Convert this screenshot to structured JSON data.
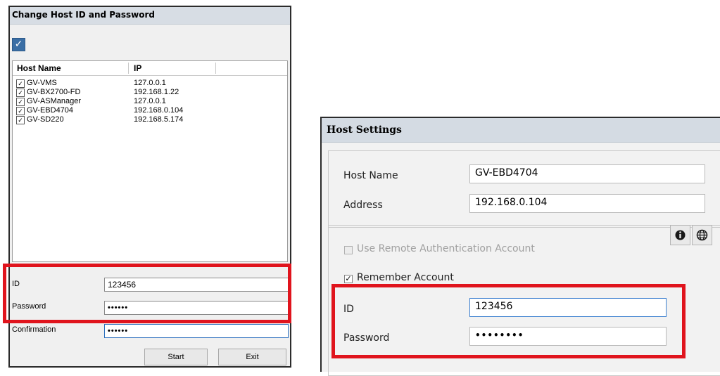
{
  "left_dialog": {
    "title": "Change Host ID and Password",
    "columns": [
      "Host Name",
      "IP"
    ],
    "hosts": [
      {
        "name": "GV-VMS",
        "ip": "127.0.0.1"
      },
      {
        "name": "GV-BX2700-FD",
        "ip": "192.168.1.22"
      },
      {
        "name": "GV-ASManager",
        "ip": "127.0.0.1"
      },
      {
        "name": "GV-EBD4704",
        "ip": "192.168.0.104"
      },
      {
        "name": "GV-SD220",
        "ip": "192.168.5.174"
      }
    ],
    "id_label": "ID",
    "id_value": "123456",
    "password_label": "Password",
    "password_value": "••••••",
    "confirmation_label": "Confirmation",
    "confirmation_value": "••••••",
    "start_button": "Start",
    "exit_button": "Exit"
  },
  "right_dialog": {
    "title": "Host Settings",
    "host_name_label": "Host Name",
    "host_name_value": "GV-EBD4704",
    "address_label": "Address",
    "address_value": "192.168.0.104",
    "remote_auth_label": "Use Remote Authentication Account",
    "remember_label": "Remember Account",
    "id_label": "ID",
    "id_value": "123456",
    "password_label": "Password",
    "password_value": "••••••••"
  },
  "highlight_color": "#e0141d"
}
